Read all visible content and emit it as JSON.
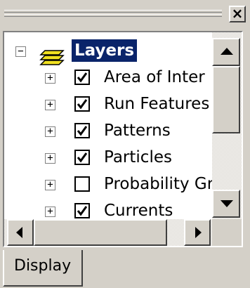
{
  "window": {
    "close_glyph": "×"
  },
  "tree": {
    "root": {
      "label": "Layers",
      "expander": "−",
      "icon": "layers-icon"
    },
    "items": [
      {
        "label": "Area of Inter",
        "checked": true,
        "expander": "+"
      },
      {
        "label": "Run Features",
        "checked": true,
        "expander": "+"
      },
      {
        "label": "Patterns",
        "checked": true,
        "expander": "+"
      },
      {
        "label": "Particles",
        "checked": true,
        "expander": "+"
      },
      {
        "label": "Probability Gr",
        "checked": false,
        "expander": "+"
      },
      {
        "label": "Currents",
        "checked": true,
        "expander": "+"
      }
    ]
  },
  "tabs": [
    {
      "label": "Display",
      "active": true
    }
  ],
  "colors": {
    "selection_bg": "#0a246a",
    "selection_text": "#ffffff",
    "layers_icon_fill": "#f0e020",
    "chrome": "#d4d0c8"
  }
}
